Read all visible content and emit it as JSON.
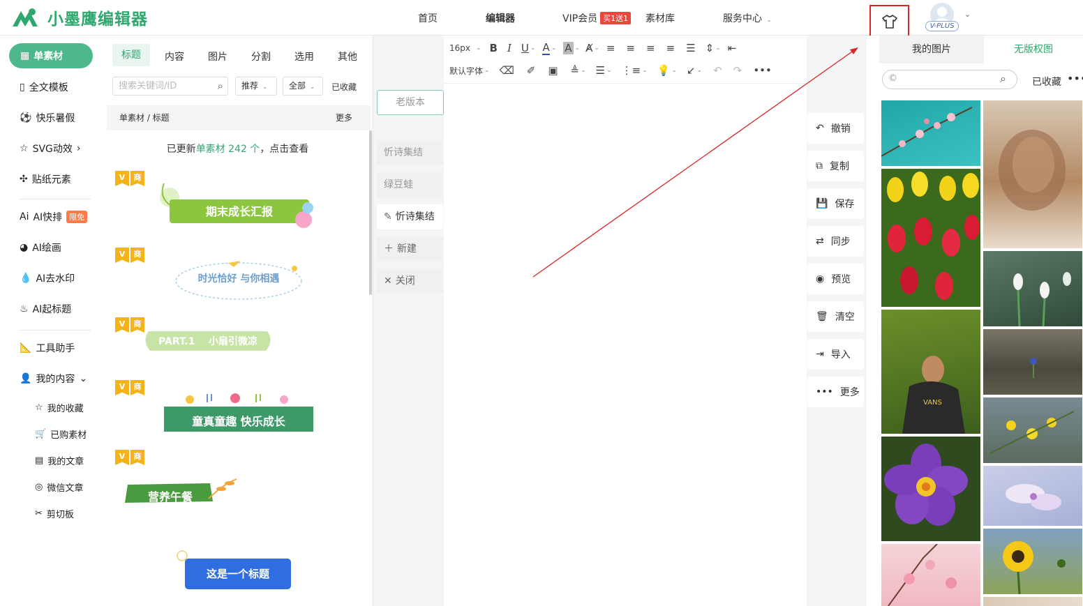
{
  "app": {
    "brand": "小墨鹰编辑器",
    "accent": "#2fa86f"
  },
  "topnav": {
    "home": "首页",
    "editor": "编辑器",
    "vip": "VIP会员",
    "vip_tag": "买1送1",
    "library": "素材库",
    "service": "服务中心",
    "vplus": "V-PLUS"
  },
  "leftnav": {
    "active": "单素材",
    "items": [
      "全文模板",
      "快乐暑假",
      "SVG动效",
      "贴纸元素",
      "AI快排",
      "AI绘画",
      "AI去水印",
      "AI起标题",
      "工具助手",
      "我的内容"
    ],
    "free_badge": "限免",
    "sub_items": [
      "我的收藏",
      "已购素材",
      "我的文章",
      "微信文章",
      "剪切板"
    ]
  },
  "material": {
    "tabs": [
      "标题",
      "内容",
      "图片",
      "分割",
      "选用",
      "其他"
    ],
    "search_placeholder": "搜索关键词/ID",
    "sort": "推荐",
    "filter": "全部",
    "favorites": "已收藏",
    "breadcrumb": "单素材 / 标题",
    "more": "更多",
    "update_prefix": "已更新",
    "update_link": "单素材 242 个",
    "update_suffix": "，点击查看",
    "vtag_v": "V",
    "vtag_shang": "商",
    "cards": [
      "期末成长汇报",
      "时光恰好 与你相遇",
      "PART.1    小扇引微凉",
      "童真童趣 快乐成长",
      "营养午餐",
      "这是一个标题"
    ]
  },
  "articles": {
    "old_version": "老版本",
    "tabs": [
      "忻诗集结",
      "绿豆蛙",
      "忻诗集结"
    ],
    "new": "新建",
    "close": "关闭"
  },
  "editor": {
    "font_size": "16px",
    "font_family": "默认字体"
  },
  "actions": [
    "撤销",
    "复制",
    "保存",
    "同步",
    "预览",
    "清空",
    "导入",
    "更多"
  ],
  "images": {
    "tab_mine": "我的图片",
    "tab_free": "无版权图",
    "favorites": "已收藏"
  }
}
